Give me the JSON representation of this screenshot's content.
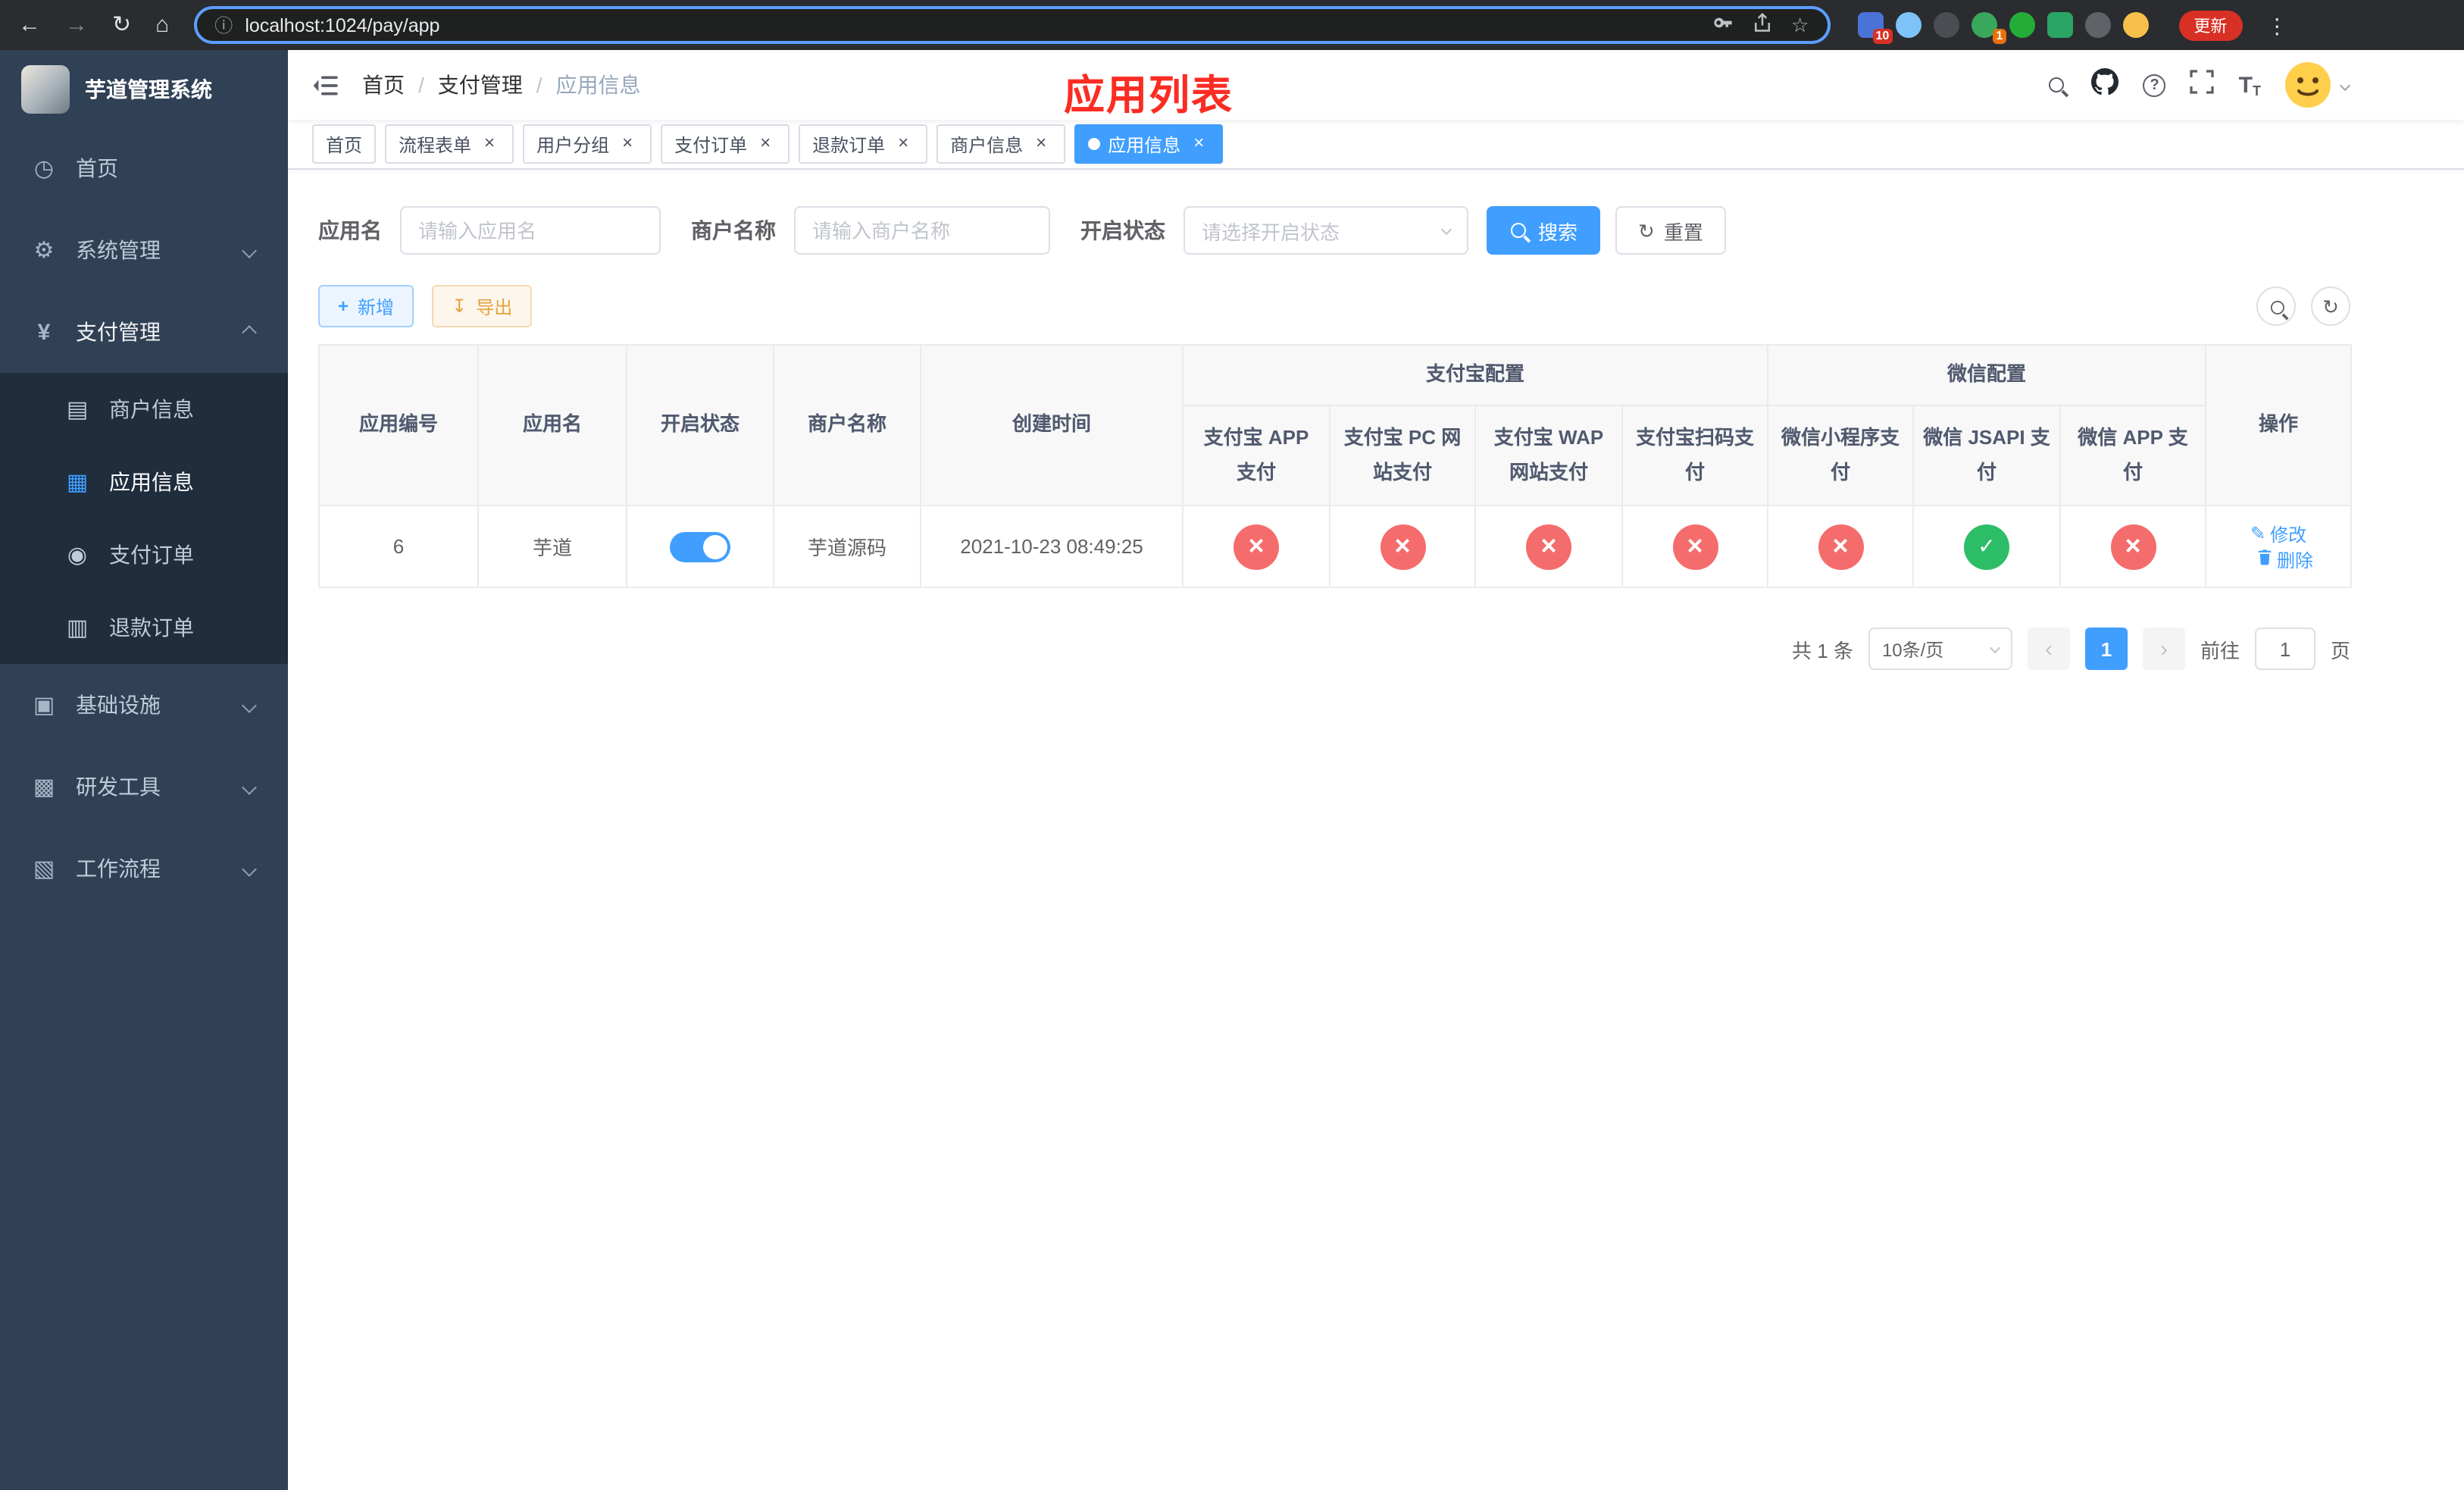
{
  "colors": {
    "primary": "#409eff",
    "danger": "#f56c6c",
    "success": "#2ebd67",
    "warning": "#e6a23c",
    "annotation_red": "#fb2c23",
    "sidebar_bg": "#304156",
    "submenu_bg": "#1f2d3d"
  },
  "icons": {
    "search-icon": "css-lens",
    "github-icon": "octocat-svg",
    "help-icon": "?",
    "fullscreen-icon": "corners-svg",
    "font-size-icon": "TT",
    "hamburger-icon": "bars-svg",
    "dashboard-icon": "◷",
    "gear-icon": "⚙",
    "yen-icon": "¥",
    "merchant-card-icon": "▤",
    "app-grid-icon": "▦",
    "order-icon": "◉",
    "refund-icon": "▥",
    "infra-icon": "▣",
    "tools-icon": "▩",
    "workflow-icon": "▧",
    "plus-icon": "+",
    "download-icon": "↧",
    "refresh-icon": "↻",
    "edit-icon": "✎",
    "trash-icon": "trash-svg",
    "close-icon": "×",
    "check-icon": "✓",
    "cross-icon": "×"
  },
  "browser": {
    "url": "localhost:1024/pay/app",
    "update_button": "更新",
    "extension_badge_1": "10",
    "extension_badge_2": "1"
  },
  "sidebar": {
    "logo_title": "芋道管理系统",
    "home": "首页",
    "system_mgmt": "系统管理",
    "payment_mgmt": "支付管理",
    "merchant_info": "商户信息",
    "app_info": "应用信息",
    "payment_order": "支付订单",
    "refund_order": "退款订单",
    "infrastructure": "基础设施",
    "dev_tools": "研发工具",
    "workflow": "工作流程"
  },
  "header": {
    "breadcrumb": [
      "首页",
      "支付管理",
      "应用信息"
    ],
    "annotation_title": "应用列表"
  },
  "tabs": [
    {
      "label": "首页",
      "closable": false,
      "active": false
    },
    {
      "label": "流程表单",
      "closable": true,
      "active": false
    },
    {
      "label": "用户分组",
      "closable": true,
      "active": false
    },
    {
      "label": "支付订单",
      "closable": true,
      "active": false
    },
    {
      "label": "退款订单",
      "closable": true,
      "active": false
    },
    {
      "label": "商户信息",
      "closable": true,
      "active": false
    },
    {
      "label": "应用信息",
      "closable": true,
      "active": true
    }
  ],
  "filters": {
    "app_name_label": "应用名",
    "app_name_placeholder": "请输入应用名",
    "merchant_label": "商户名称",
    "merchant_placeholder": "请输入商户名称",
    "status_label": "开启状态",
    "status_placeholder": "请选择开启状态",
    "search": "搜索",
    "reset": "重置"
  },
  "toolbar": {
    "add": "新增",
    "export": "导出"
  },
  "table": {
    "col_app_id": "应用编号",
    "col_app_name": "应用名",
    "col_status": "开启状态",
    "col_merchant": "商户名称",
    "col_created": "创建时间",
    "group_alipay": "支付宝配置",
    "group_wechat": "微信配置",
    "col_alipay_app": "支付宝 APP 支付",
    "col_alipay_pc": "支付宝 PC 网站支付",
    "col_alipay_wap": "支付宝 WAP 网站支付",
    "col_alipay_qr": "支付宝扫码支付",
    "col_wechat_mini": "微信小程序支付",
    "col_wechat_jsapi": "微信 JSAPI 支付",
    "col_wechat_app": "微信 APP 支付",
    "col_actions": "操作",
    "rows": [
      {
        "id": "6",
        "name": "芋道",
        "enabled": "on",
        "merchant": "芋道源码",
        "created": "2021-10-23 08:49:25",
        "alipay_app": "no",
        "alipay_pc": "no",
        "alipay_wap": "no",
        "alipay_qr": "no",
        "wechat_mini": "no",
        "wechat_jsapi": "yes",
        "wechat_app": "no",
        "edit": "修改",
        "delete": "删除"
      }
    ]
  },
  "pagination": {
    "total": "共 1 条",
    "page_size": "10条/页",
    "current_page": "1",
    "goto_label": "前往",
    "goto_value": "1",
    "page_unit": "页"
  }
}
